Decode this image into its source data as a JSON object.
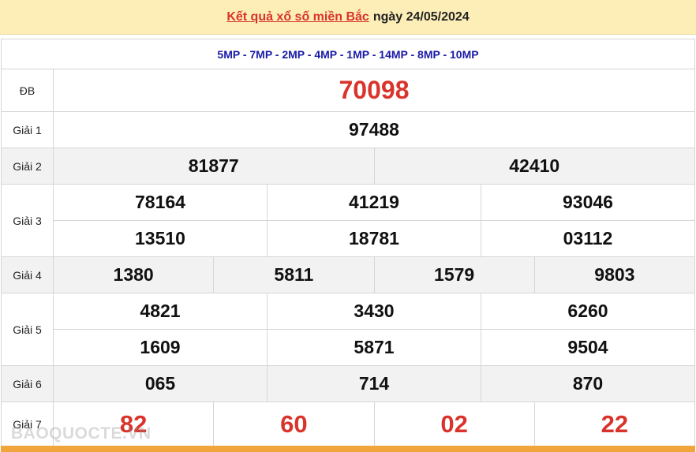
{
  "header": {
    "title_link": "Kết quả xổ số miền Bắc",
    "title_date": "ngày 24/05/2024"
  },
  "codes": "5MP - 7MP - 2MP - 4MP - 1MP - 14MP - 8MP - 10MP",
  "prizes": [
    {
      "label": "ĐB",
      "lines": [
        [
          "70098"
        ]
      ]
    },
    {
      "label": "Giải 1",
      "lines": [
        [
          "97488"
        ]
      ]
    },
    {
      "label": "Giải 2",
      "lines": [
        [
          "81877",
          "42410"
        ]
      ]
    },
    {
      "label": "Giải 3",
      "lines": [
        [
          "78164",
          "41219",
          "93046"
        ],
        [
          "13510",
          "18781",
          "03112"
        ]
      ]
    },
    {
      "label": "Giải 4",
      "lines": [
        [
          "1380",
          "5811",
          "1579",
          "9803"
        ]
      ]
    },
    {
      "label": "Giải 5",
      "lines": [
        [
          "4821",
          "3430",
          "6260"
        ],
        [
          "1609",
          "5871",
          "9504"
        ]
      ]
    },
    {
      "label": "Giải 6",
      "lines": [
        [
          "065",
          "714",
          "870"
        ]
      ]
    },
    {
      "label": "Giải 7",
      "lines": [
        [
          "82",
          "60",
          "02",
          "22"
        ]
      ]
    }
  ],
  "watermark": "BAOQUOCTE.VN"
}
